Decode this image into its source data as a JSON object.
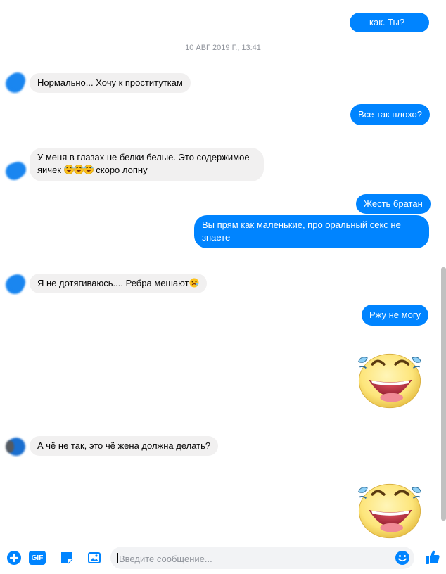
{
  "colors": {
    "accent": "#0084ff",
    "incoming_bubble": "#f1f0f0",
    "timestamp": "#90949c"
  },
  "timestamp": "10 АВГ 2019 Г., 13:41",
  "messages": [
    {
      "side": "out",
      "text": "как. Ты?"
    },
    {
      "side": "in",
      "text": "Нормально... Хочу к проституткам"
    },
    {
      "side": "out",
      "text": "Все так плохо?"
    },
    {
      "side": "in",
      "line1": "У меня в глазах не белки белые. Это содержимое",
      "line2_pre": "яичек",
      "line2_post": "скоро лопну",
      "emoji": "rofl-emoji"
    },
    {
      "side": "out",
      "text": "Жесть братан"
    },
    {
      "side": "out",
      "line1": "Вы прям как маленькие, про оральный секс не",
      "line2": "знаете"
    },
    {
      "side": "in",
      "text": "Я не дотягиваюсь.... Ребра мешают",
      "emoji": "crying-face-emoji"
    },
    {
      "side": "out",
      "text": "Ржу не могу"
    },
    {
      "side": "out",
      "sticker": "laughing-tears-sticker"
    },
    {
      "side": "in",
      "text": "А чё не так, это чё жена должна делать?"
    },
    {
      "side": "out",
      "sticker": "laughing-tears-sticker"
    }
  ],
  "composer": {
    "placeholder": "Введите сообщение...",
    "gif_label": "GIF",
    "icons": [
      "plus-circle-icon",
      "gif-icon",
      "sticker-icon",
      "photo-icon",
      "emoji-icon",
      "thumbs-up-icon"
    ]
  }
}
